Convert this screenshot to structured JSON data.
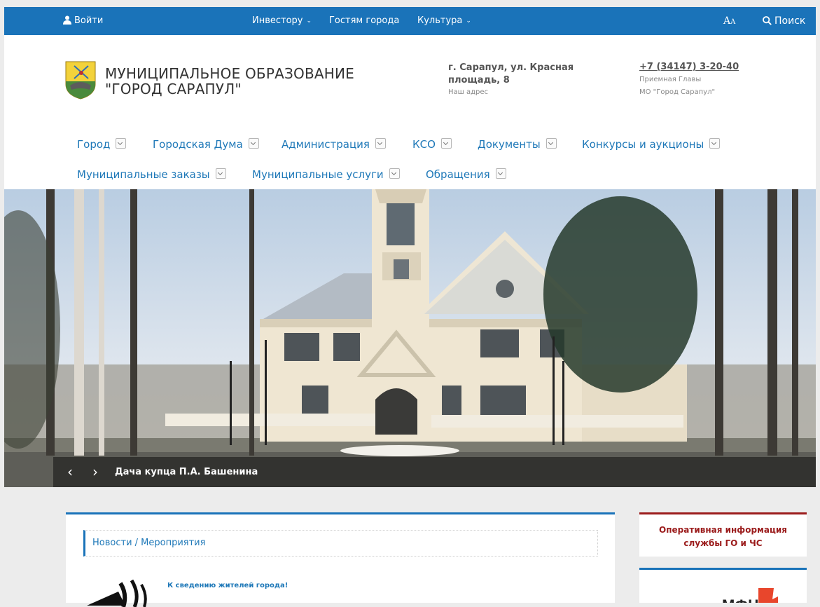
{
  "topbar": {
    "login": "Войти",
    "investor": "Инвестору",
    "guests": "Гостям города",
    "culture": "Культура",
    "font_size_big": "A",
    "font_size_small": "A",
    "search": "Поиск"
  },
  "header": {
    "title_line1": "МУНИЦИПАЛЬНОЕ ОБРАЗОВАНИЕ",
    "title_line2": "\"ГОРОД САРАПУЛ\"",
    "address": "г. Сарапул, ул. Красная площадь, 8",
    "address_label": "Наш адрес",
    "phone": "+7 (34147) 3-20-40",
    "phone_label1": "Приемная Главы",
    "phone_label2": "МО \"Город Сарапул\""
  },
  "menu": [
    {
      "label": "Город"
    },
    {
      "label": "Городская Дума"
    },
    {
      "label": "Администрация"
    },
    {
      "label": "КСО"
    },
    {
      "label": "Документы"
    },
    {
      "label": "Конкурсы и аукционы"
    },
    {
      "label": "Муниципальные заказы"
    },
    {
      "label": "Муниципальные услуги"
    },
    {
      "label": "Обращения"
    }
  ],
  "slider": {
    "caption": "Дача купца П.А. Башенина",
    "prev": "‹",
    "next": "›"
  },
  "news": {
    "heading": "Новости / Мероприятия",
    "item_title": "К сведению жителей города!"
  },
  "sidebar": {
    "alert_line1": "Оперативная информация",
    "alert_line2": "службы ГО и ЧС",
    "mfc_logo_text": "МФЦ"
  },
  "colors": {
    "accent": "#1a73b9",
    "alert": "#9b1c1c",
    "link": "#1e78b8"
  }
}
